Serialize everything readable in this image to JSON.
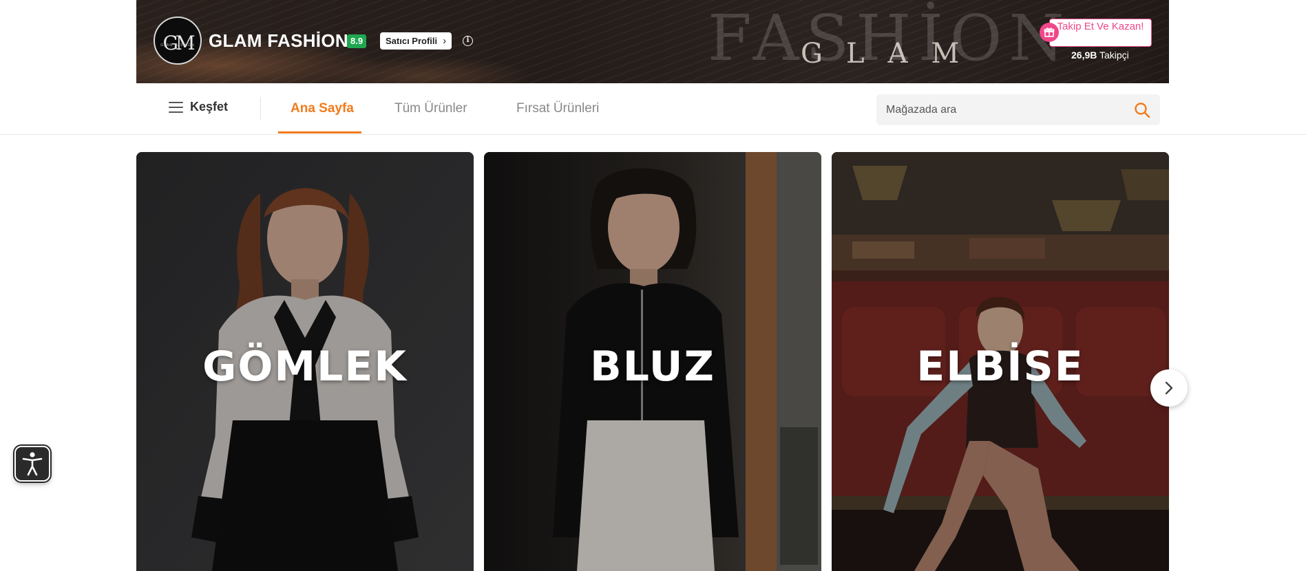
{
  "store": {
    "name": "GLAM FASHİON",
    "score": "8.9",
    "seller_profile_label": "Satıcı Profili",
    "banner_watermark": "FASHİON",
    "banner_brand": "GLAM",
    "logo_monogram": "GM",
    "logo_small_text": "GLAM FASHION",
    "follow_button": "Takip Et Ve Kazan!",
    "followers_count": "26,9B",
    "followers_label": "Takipçi"
  },
  "nav": {
    "menu_label": "Keşfet",
    "tabs": [
      {
        "label": "Ana Sayfa",
        "active": true
      },
      {
        "label": "Tüm Ürünler",
        "active": false
      },
      {
        "label": "Fırsat Ürünleri",
        "active": false
      }
    ],
    "search_placeholder": "Mağazada ara"
  },
  "carousel": {
    "cards": [
      {
        "label": "GÖMLEK"
      },
      {
        "label": "BLUZ"
      },
      {
        "label": "ELBİSE"
      }
    ]
  },
  "colors": {
    "accent": "#f27a1a",
    "follow_pink": "#f0478b",
    "score_green": "#1fa84f"
  }
}
